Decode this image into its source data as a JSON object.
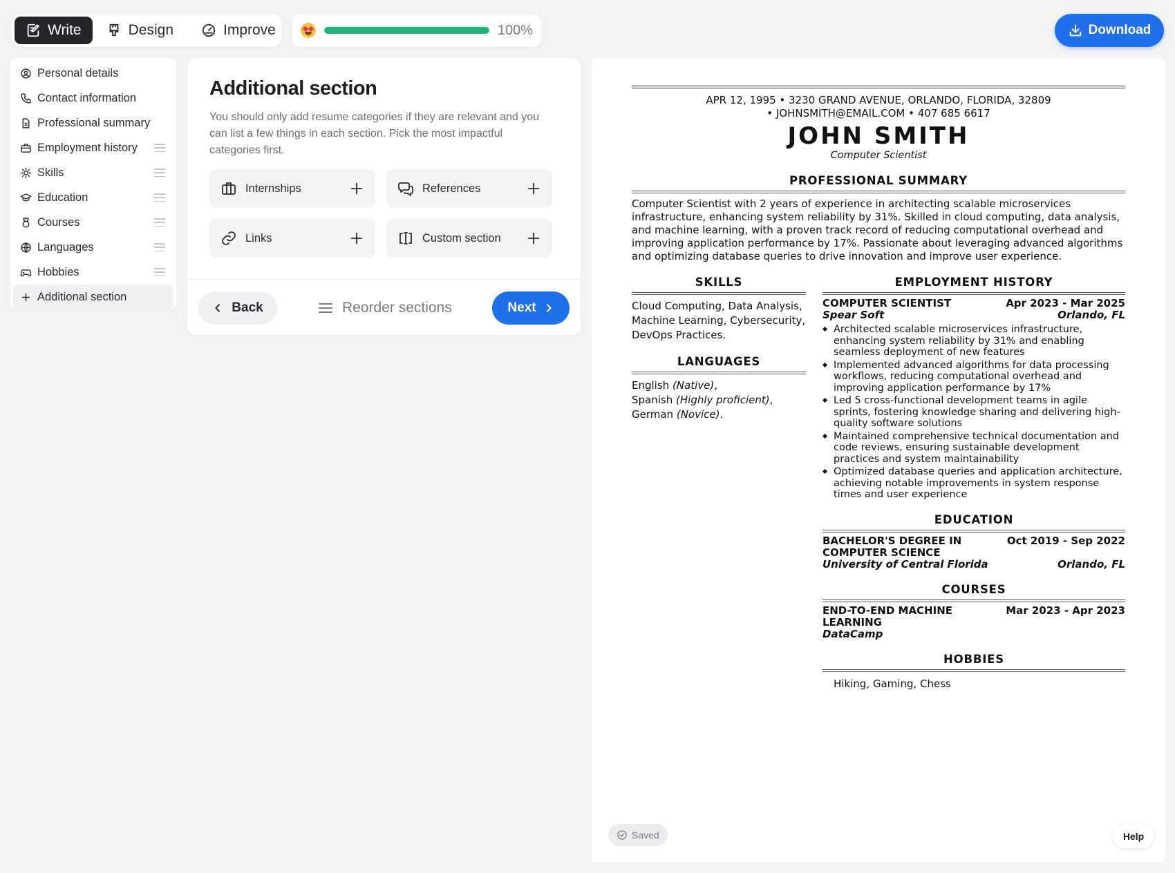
{
  "mode_tabs": {
    "write": "Write",
    "design": "Design",
    "improve": "Improve"
  },
  "progress": {
    "value": 1.0,
    "label": "100%",
    "emoji": "star-struck"
  },
  "download": {
    "label": "Download"
  },
  "sidebar": {
    "items": [
      {
        "label": "Personal details",
        "icon": "user-circle-icon"
      },
      {
        "label": "Contact information",
        "icon": "phone-icon"
      },
      {
        "label": "Professional summary",
        "icon": "document-icon"
      },
      {
        "label": "Employment history",
        "icon": "briefcase-icon"
      },
      {
        "label": "Skills",
        "icon": "sparkle-icon"
      },
      {
        "label": "Education",
        "icon": "graduation-cap-icon"
      },
      {
        "label": "Courses",
        "icon": "medal-icon"
      },
      {
        "label": "Languages",
        "icon": "globe-icon"
      },
      {
        "label": "Hobbies",
        "icon": "gamepad-icon"
      },
      {
        "label": "Additional section",
        "icon": "plus-icon"
      }
    ]
  },
  "main": {
    "title": "Additional section",
    "description": "You should only add resume categories if they are relevant and you can list a few things in each section. Pick the most impactful categories first.",
    "options": [
      {
        "label": "Internships",
        "icon": "briefcase-icon"
      },
      {
        "label": "References",
        "icon": "chat-bubbles-icon"
      },
      {
        "label": "Links",
        "icon": "link-icon"
      },
      {
        "label": "Custom section",
        "icon": "text-cursor-icon"
      }
    ],
    "back_label": "Back",
    "reorder_label": "Reorder sections",
    "next_label": "Next"
  },
  "resume": {
    "contact_line1": "APR 12, 1995 • 3230 GRAND AVENUE, ORLANDO, FLORIDA, 32809",
    "contact_line2": "• JOHNSMITH@EMAIL.COM • 407 685 6617",
    "name": "JOHN SMITH",
    "role": "Computer Scientist",
    "summary_heading": "PROFESSIONAL SUMMARY",
    "summary": "Computer Scientist with 2 years of experience in architecting scalable microservices infrastructure, enhancing system reliability by 31%. Skilled in cloud computing, data analysis, and machine learning, with a proven track record of reducing computational overhead and improving application performance by 17%. Passionate about leveraging advanced algorithms and optimizing database queries to drive innovation and improve user experience.",
    "skills_heading": "SKILLS",
    "skills": "Cloud Computing, Data Analysis, Machine Learning, Cybersecurity, DevOps Practices.",
    "languages_heading": "LANGUAGES",
    "languages": [
      {
        "name": "English",
        "level": "(Native)",
        "sep": ","
      },
      {
        "name": "Spanish",
        "level": "(Highly proficient)",
        "sep": ","
      },
      {
        "name": "German",
        "level": "(Novice)",
        "sep": "."
      }
    ],
    "employment_heading": "EMPLOYMENT HISTORY",
    "job": {
      "title": "COMPUTER SCIENTIST",
      "dates": "Apr 2023 - Mar 2025",
      "company": "Spear Soft",
      "location": "Orlando, FL",
      "bullets": [
        "Architected scalable microservices infrastructure, enhancing system reliability by 31% and enabling seamless deployment of new features",
        "Implemented advanced algorithms for data processing workflows, reducing computational overhead and improving application performance by 17%",
        "Led 5 cross-functional development teams in agile sprints, fostering knowledge sharing and delivering high-quality software solutions",
        "Maintained comprehensive technical documentation and code reviews, ensuring sustainable development practices and system maintainability",
        "Optimized database queries and application architecture, achieving notable improvements in system response times and user experience"
      ]
    },
    "education_heading": "EDUCATION",
    "education": {
      "degree_line1": "BACHELOR'S DEGREE IN",
      "degree_line2": "COMPUTER SCIENCE",
      "dates": "Oct 2019 - Sep 2022",
      "school": "University of Central Florida",
      "location": "Orlando, FL"
    },
    "courses_heading": "COURSES",
    "course": {
      "name_line1": "END-TO-END MACHINE",
      "name_line2": "LEARNING",
      "dates": "Mar 2023 - Apr 2023",
      "provider": "DataCamp"
    },
    "hobbies_heading": "HOBBIES",
    "hobbies": "Hiking, Gaming, Chess"
  },
  "status": {
    "saved": "Saved"
  },
  "help": {
    "label": "Help"
  },
  "colors": {
    "accent": "#1f6feb",
    "progress": "#1bb47b",
    "dark_tab": "#26262a"
  }
}
